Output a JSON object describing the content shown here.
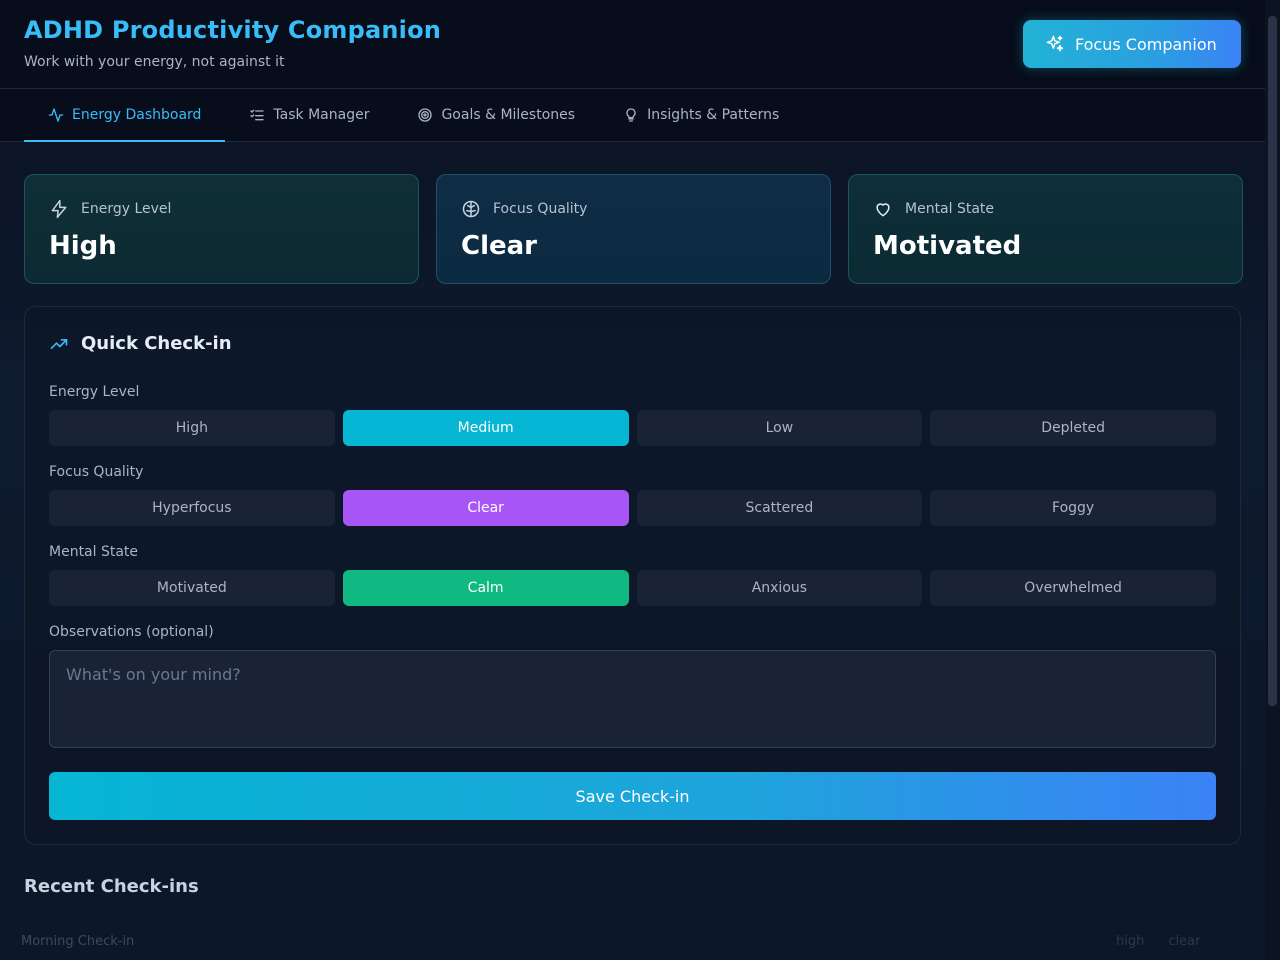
{
  "header": {
    "title": "ADHD Productivity Companion",
    "subtitle": "Work with your energy, not against it",
    "focus_button_label": "Focus Companion"
  },
  "tabs": [
    {
      "label": "Energy Dashboard",
      "icon": "activity-icon",
      "active": true
    },
    {
      "label": "Task Manager",
      "icon": "list-checks-icon",
      "active": false
    },
    {
      "label": "Goals & Milestones",
      "icon": "target-icon",
      "active": false
    },
    {
      "label": "Insights & Patterns",
      "icon": "lightbulb-icon",
      "active": false
    }
  ],
  "stats": {
    "energy": {
      "label": "Energy Level",
      "value": "High",
      "icon": "bolt-icon"
    },
    "focus": {
      "label": "Focus Quality",
      "value": "Clear",
      "icon": "brain-icon"
    },
    "mental": {
      "label": "Mental State",
      "value": "Motivated",
      "icon": "heart-icon"
    }
  },
  "checkin": {
    "title": "Quick Check-in",
    "energy_label": "Energy Level",
    "energy_options": [
      "High",
      "Medium",
      "Low",
      "Depleted"
    ],
    "energy_selected": "Medium",
    "focus_label": "Focus Quality",
    "focus_options": [
      "Hyperfocus",
      "Clear",
      "Scattered",
      "Foggy"
    ],
    "focus_selected": "Clear",
    "mental_label": "Mental State",
    "mental_options": [
      "Motivated",
      "Calm",
      "Anxious",
      "Overwhelmed"
    ],
    "mental_selected": "Calm",
    "observations_label": "Observations (optional)",
    "observations_placeholder": "What's on your mind?",
    "observations_value": "",
    "save_label": "Save Check-in"
  },
  "recent": {
    "title": "Recent Check-ins",
    "items": [
      {
        "title": "Morning Check-in",
        "tags": [
          "high",
          "clear"
        ]
      }
    ]
  },
  "colors": {
    "accent": "#38bdf8",
    "energy_selected": "#06b6d4",
    "focus_selected": "#a855f7",
    "mental_selected": "#10b981"
  }
}
